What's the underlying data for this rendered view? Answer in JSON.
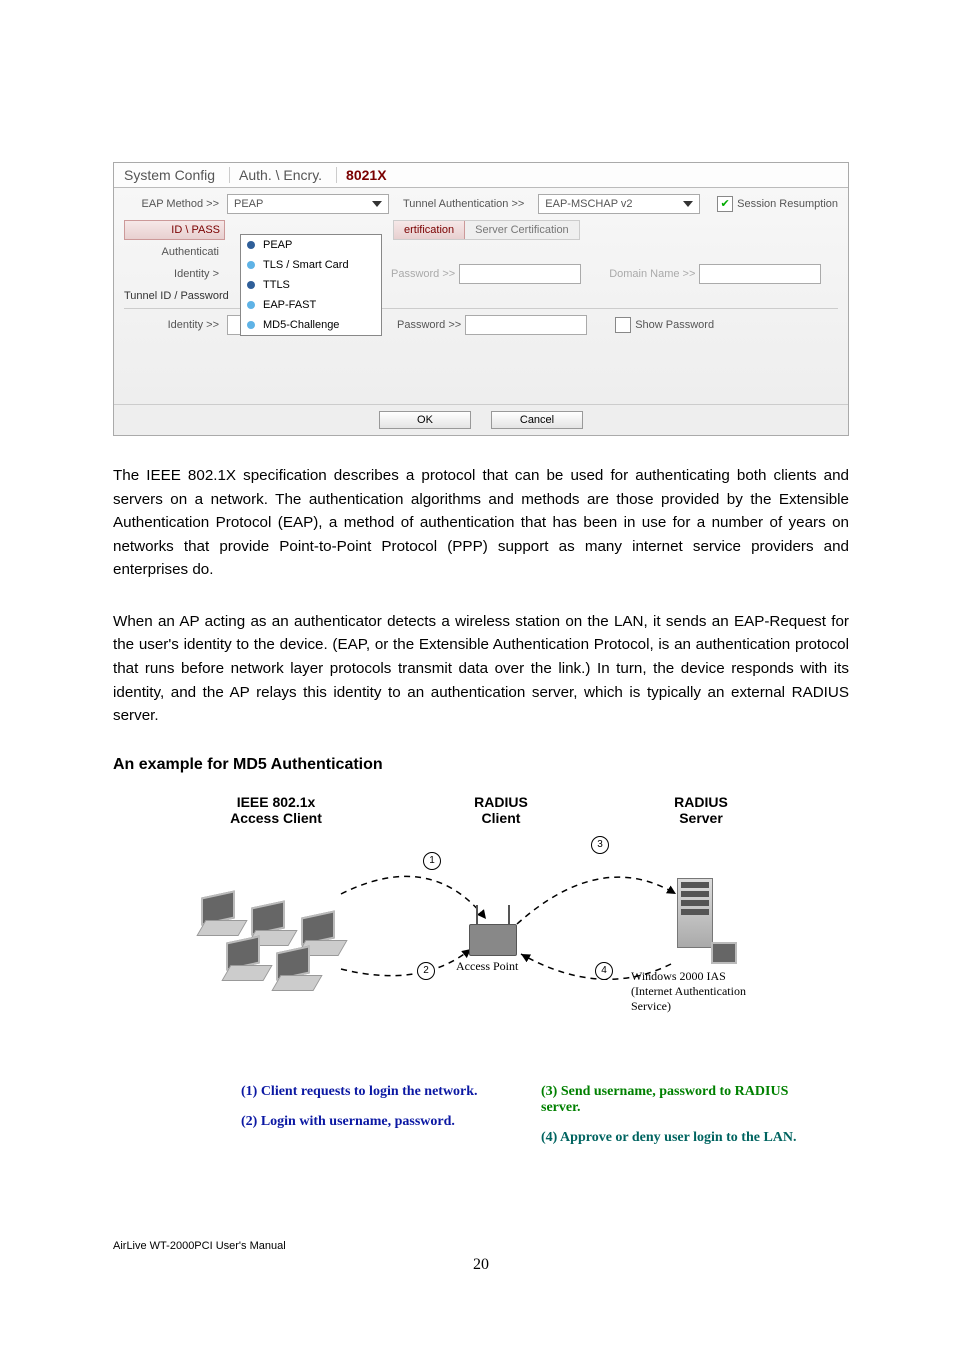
{
  "ui": {
    "tabs": [
      "System Config",
      "Auth. \\ Encry.",
      "8021X"
    ],
    "selected_tab_index": 2,
    "eap_method_label": "EAP Method >>",
    "eap_method_selected": "PEAP",
    "eap_method_options": [
      "PEAP",
      "TLS / Smart Card",
      "TTLS",
      "EAP-FAST",
      "MD5-Challenge"
    ],
    "tunnel_auth_label": "Tunnel Authentication >>",
    "tunnel_auth_selected": "EAP-MSCHAP v2",
    "session_resumption_label": "Session Resumption",
    "session_resumption_checked": true,
    "side_tab_selected": "ID \\ PASS",
    "side_tab_authentication": "Authenticati",
    "sub_tabs_top": [
      "ertification",
      "Server Certification"
    ],
    "identity_label_upper": "Identity >",
    "identity_label_lower": "Identity >>",
    "password_label": "Password >>",
    "domain_name_label": "Domain Name >>",
    "tunnel_id_label": "Tunnel ID / Password",
    "show_password_label": "Show Password",
    "buttons": {
      "ok": "OK",
      "cancel": "Cancel"
    }
  },
  "body": {
    "para1": "The IEEE 802.1X specification describes a protocol that can be used for authenticating both clients and servers on a network. The authentication algorithms and methods are those provided by the Extensible Authentication Protocol (EAP), a method of authentication that has been in use for a number of years on networks that provide Point-to-Point Protocol (PPP) support as many internet service providers and enterprises do.",
    "para2": "When an AP acting as an authenticator detects a wireless station on the LAN, it sends an EAP-Request for the user's identity to the device. (EAP, or the Extensible Authentication Protocol, is an authentication protocol that runs before network layer protocols transmit data over the link.) In turn, the device responds with its identity, and the AP relays this identity to an authentication server, which is typically an external RADIUS server.",
    "heading": "An example for MD5 Authentication"
  },
  "diagram": {
    "labels": {
      "client": "IEEE 802.1x\nAccess Client",
      "radius_client": "RADIUS\nClient",
      "radius_server": "RADIUS\nServer",
      "access_point": "Access Point",
      "ias": "Windows 2000 IAS\n(Internet Authentication\nService)"
    },
    "steps": [
      "(1) Client requests to login the network.",
      "(2) Login with username, password.",
      "(3) Send username, password to RADIUS server.",
      "(4) Approve or deny user login to the LAN."
    ]
  },
  "footer": {
    "text": "AirLive WT-2000PCI User's Manual",
    "page": "20"
  }
}
